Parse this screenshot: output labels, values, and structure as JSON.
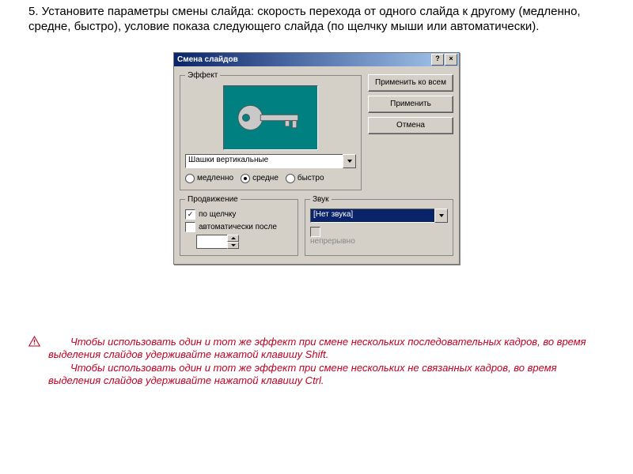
{
  "task": "5.  Установите параметры смены слайда: скорость перехода от одного слайда к другому (медленно, средне, быстро), условие показа следующего слайда (по щелчку мыши или автоматически).",
  "dialog": {
    "title": "Смена слайдов",
    "help": "?",
    "close": "×",
    "effect_legend": "Эффект",
    "dropdown_value": "Шашки вертикальные",
    "speed": {
      "slow": "медленно",
      "medium": "средне",
      "fast": "быстро"
    },
    "advance_legend": "Продвижение",
    "on_click": "по щелчку",
    "auto_after": "автоматически после",
    "sound_legend": "Звук",
    "sound_value": "[Нет звука]",
    "loop": "непрерывно",
    "buttons": {
      "apply_all": "Применить ко всем",
      "apply": "Применить",
      "cancel": "Отмена"
    }
  },
  "note": {
    "p1": "Чтобы использовать один и тот же эффект при смене нескольких последовательных кадров, во время выделения слайдов удерживайте нажатой клавишу Shift.",
    "p2": "Чтобы использовать один и тот же эффект при смене нескольких не связанных кадров, во время выделения слайдов удерживайте нажатой клавишу Ctrl."
  }
}
